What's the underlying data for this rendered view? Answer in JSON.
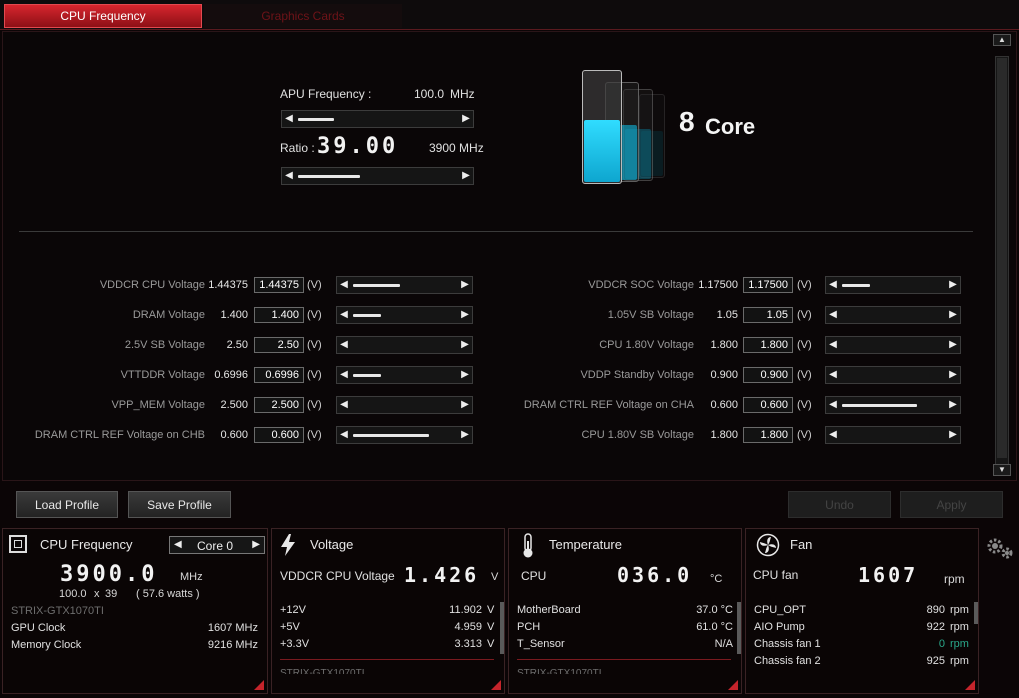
{
  "tabs": [
    {
      "label": "CPU Frequency",
      "active": true
    },
    {
      "label": "Graphics Cards",
      "active": false
    }
  ],
  "freq": {
    "apu_label": "APU Frequency :",
    "apu_value": "100.0",
    "apu_unit": "MHz",
    "ratio_label": "Ratio :",
    "ratio_value": "39.00",
    "ratio_mhz": "3900 MHz"
  },
  "core_badge": {
    "number": "8",
    "label": "Core"
  },
  "voltages_left": [
    {
      "name": "VDDCR CPU Voltage",
      "value": "1.44375",
      "input": "1.44375",
      "unit": "(V)",
      "level": 0.5
    },
    {
      "name": "DRAM Voltage",
      "value": "1.400",
      "input": "1.400",
      "unit": "(V)",
      "level": 0.3
    },
    {
      "name": "2.5V SB Voltage",
      "value": "2.50",
      "input": "2.50",
      "unit": "(V)",
      "level": 0
    },
    {
      "name": "VTTDDR Voltage",
      "value": "0.6996",
      "input": "0.6996",
      "unit": "(V)",
      "level": 0.3
    },
    {
      "name": "VPP_MEM Voltage",
      "value": "2.500",
      "input": "2.500",
      "unit": "(V)",
      "level": 0
    },
    {
      "name": "DRAM CTRL REF Voltage on CHB",
      "value": "0.600",
      "input": "0.600",
      "unit": "(V)",
      "level": 0.8
    }
  ],
  "voltages_right": [
    {
      "name": "VDDCR SOC Voltage",
      "value": "1.17500",
      "input": "1.17500",
      "unit": "(V)",
      "level": 0.3
    },
    {
      "name": "1.05V SB Voltage",
      "value": "1.05",
      "input": "1.05",
      "unit": "(V)",
      "level": 0
    },
    {
      "name": "CPU 1.80V Voltage",
      "value": "1.800",
      "input": "1.800",
      "unit": "(V)",
      "level": 0
    },
    {
      "name": "VDDP Standby Voltage",
      "value": "0.900",
      "input": "0.900",
      "unit": "(V)",
      "level": 0
    },
    {
      "name": "DRAM CTRL REF Voltage on CHA",
      "value": "0.600",
      "input": "0.600",
      "unit": "(V)",
      "level": 0.8
    },
    {
      "name": "CPU 1.80V SB Voltage",
      "value": "1.800",
      "input": "1.800",
      "unit": "(V)",
      "level": 0
    }
  ],
  "profile": {
    "load": "Load Profile",
    "save": "Save Profile",
    "undo": "Undo",
    "apply": "Apply"
  },
  "cpu_panel": {
    "title": "CPU Frequency",
    "core_select": "Core 0",
    "big_value": "3900.0",
    "big_unit": "MHz",
    "calc_left": "100.0",
    "calc_x": "x",
    "calc_right": "39",
    "calc_watts": "( 57.6 watts )",
    "gpu_name": "STRIX-GTX1070TI",
    "rows": [
      {
        "label": "GPU Clock",
        "value": "1607 MHz"
      },
      {
        "label": "Memory Clock",
        "value": "9216 MHz"
      }
    ]
  },
  "voltage_panel": {
    "title": "Voltage",
    "main_label": "VDDCR CPU Voltage",
    "main_value": "1.426",
    "main_unit": "V",
    "rows": [
      {
        "label": "+12V",
        "value": "11.902",
        "unit": "V"
      },
      {
        "label": "+5V",
        "value": "4.959",
        "unit": "V"
      },
      {
        "label": "+3.3V",
        "value": "3.313",
        "unit": "V"
      }
    ],
    "footer": "STRIX-GTX1070TI"
  },
  "temp_panel": {
    "title": "Temperature",
    "main_label": "CPU",
    "main_value": "036.0",
    "main_unit": "°C",
    "rows": [
      {
        "label": "MotherBoard",
        "value": "37.0 °C"
      },
      {
        "label": "PCH",
        "value": "61.0 °C"
      },
      {
        "label": "T_Sensor",
        "value": "N/A"
      }
    ],
    "footer": "STRIX-GTX1070TI"
  },
  "fan_panel": {
    "title": "Fan",
    "main_label": "CPU fan",
    "main_value": "1607",
    "main_unit": "rpm",
    "rows": [
      {
        "label": "CPU_OPT",
        "value": "890",
        "unit": "rpm"
      },
      {
        "label": "AIO Pump",
        "value": "922",
        "unit": "rpm"
      },
      {
        "label": "Chassis fan 1",
        "value": "0",
        "unit": "rpm"
      },
      {
        "label": "Chassis fan 2",
        "value": "925",
        "unit": "rpm"
      }
    ]
  },
  "colors": {
    "accent": "#d7262e",
    "cyan": "#1ec8f0",
    "zero_rpm": "#2aa88a"
  },
  "icons": {
    "cpu": "cpu-chip-icon",
    "voltage": "lightning-icon",
    "temperature": "thermometer-icon",
    "fan": "fan-icon",
    "settings": "gears-icon"
  }
}
